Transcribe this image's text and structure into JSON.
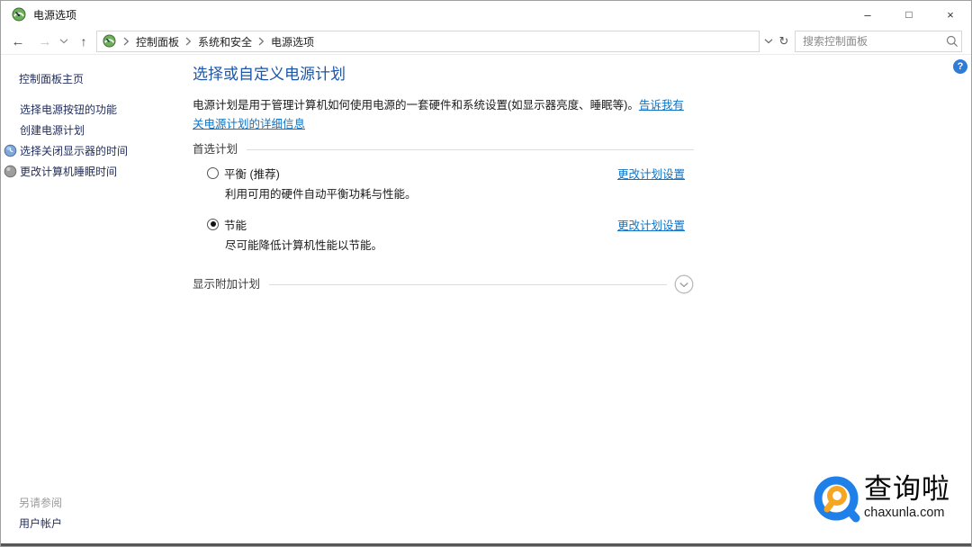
{
  "window": {
    "title": "电源选项",
    "controls": {
      "minimize": "–",
      "maximize": "□",
      "close": "×"
    }
  },
  "toolbar": {
    "back_glyph": "←",
    "forward_glyph": "→",
    "up_glyph": "↑",
    "refresh_glyph": "↻",
    "breadcrumb": [
      "控制面板",
      "系统和安全",
      "电源选项"
    ],
    "search": {
      "placeholder": "搜索控制面板"
    }
  },
  "help": {
    "glyph": "?"
  },
  "sidebar": {
    "home": "控制面板主页",
    "tasks": [
      {
        "label": "选择电源按钮的功能"
      },
      {
        "label": "创建电源计划"
      },
      {
        "label": "选择关闭显示器的时间",
        "icon": "display-clock-icon"
      },
      {
        "label": "更改计算机睡眠时间",
        "icon": "sleep-icon"
      }
    ],
    "see_also": "另请参阅",
    "see_also_links": [
      "用户帐户"
    ]
  },
  "main": {
    "title": "选择或自定义电源计划",
    "description": "电源计划是用于管理计算机如何使用电源的一套硬件和系统设置(如显示器亮度、睡眠等)。",
    "learn_more_link": "告诉我有关电源计划的详细信息",
    "sections": {
      "preferred": "首选计划",
      "additional": "显示附加计划"
    },
    "plans": [
      {
        "name": "平衡 (推荐)",
        "description": "利用可用的硬件自动平衡功耗与性能。",
        "selected": false,
        "settings_link": "更改计划设置"
      },
      {
        "name": "节能",
        "description": "尽可能降低计算机性能以节能。",
        "selected": true,
        "settings_link": "更改计划设置"
      }
    ]
  },
  "watermark": {
    "name": "查询啦",
    "domain": "chaxunla.com"
  },
  "colors": {
    "heading": "#1d56a5",
    "link": "#1173c5",
    "sidebar_link": "#232f5c",
    "help_badge": "#2f7cd6",
    "logo_blue": "#1e80e8",
    "logo_orange": "#f5a623"
  }
}
